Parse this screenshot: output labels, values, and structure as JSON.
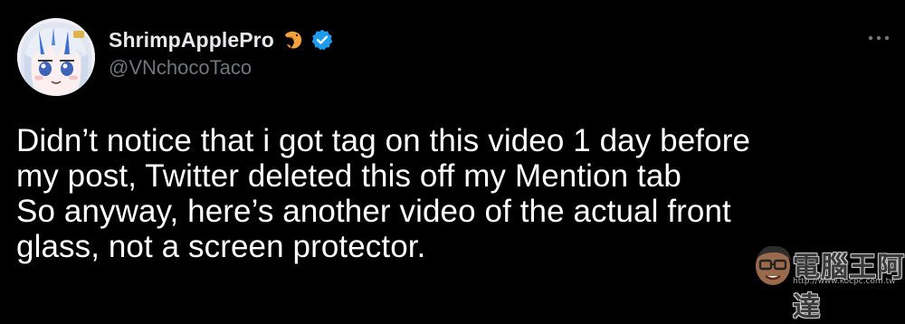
{
  "author": {
    "display_name": "ShrimpApplePro",
    "handle": "@VNchocoTaco",
    "emoji_icon": "shrimp-emoji-icon",
    "badge_icon": "verified-badge-icon",
    "badge_color": "#1d9bf0"
  },
  "tweet": {
    "lines": [
      "Didn’t notice that i got tag on this video 1 day before",
      "my post, Twitter deleted this off my Mention tab",
      "So anyway, here’s another video of the actual front",
      "glass, not a screen protector."
    ]
  },
  "more_icon": "more-options-icon",
  "watermark": {
    "text": "電腦王阿達",
    "url": "http://www.kocpc.com.tw"
  },
  "colors": {
    "background": "#000000",
    "text": "#e7e9ea",
    "secondary": "#71767b"
  }
}
